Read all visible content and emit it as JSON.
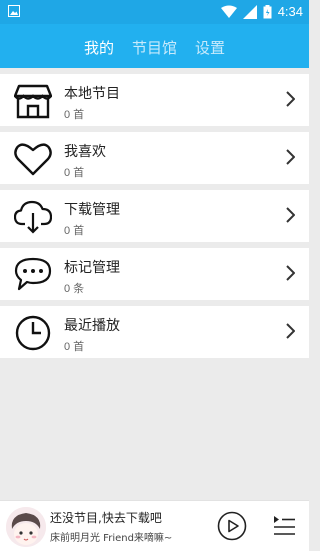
{
  "status": {
    "time": "4:34"
  },
  "tabs": [
    {
      "label": "我的"
    },
    {
      "label": "节目馆"
    },
    {
      "label": "设置"
    }
  ],
  "items": [
    {
      "title": "本地节目",
      "count": "0 首",
      "icon": "store-icon"
    },
    {
      "title": "我喜欢",
      "count": "0 首",
      "icon": "heart-icon"
    },
    {
      "title": "下载管理",
      "count": "0 首",
      "icon": "cloud-download-icon"
    },
    {
      "title": "标记管理",
      "count": "0 条",
      "icon": "chat-bubble-icon"
    },
    {
      "title": "最近播放",
      "count": "0 首",
      "icon": "clock-icon"
    }
  ],
  "player": {
    "title": "还没节目,快去下载吧",
    "subtitle": "床前明月光 Friend来嘀嘛~"
  },
  "colors": {
    "header": "#22b0ef",
    "statusbar": "#1fa7e6"
  }
}
